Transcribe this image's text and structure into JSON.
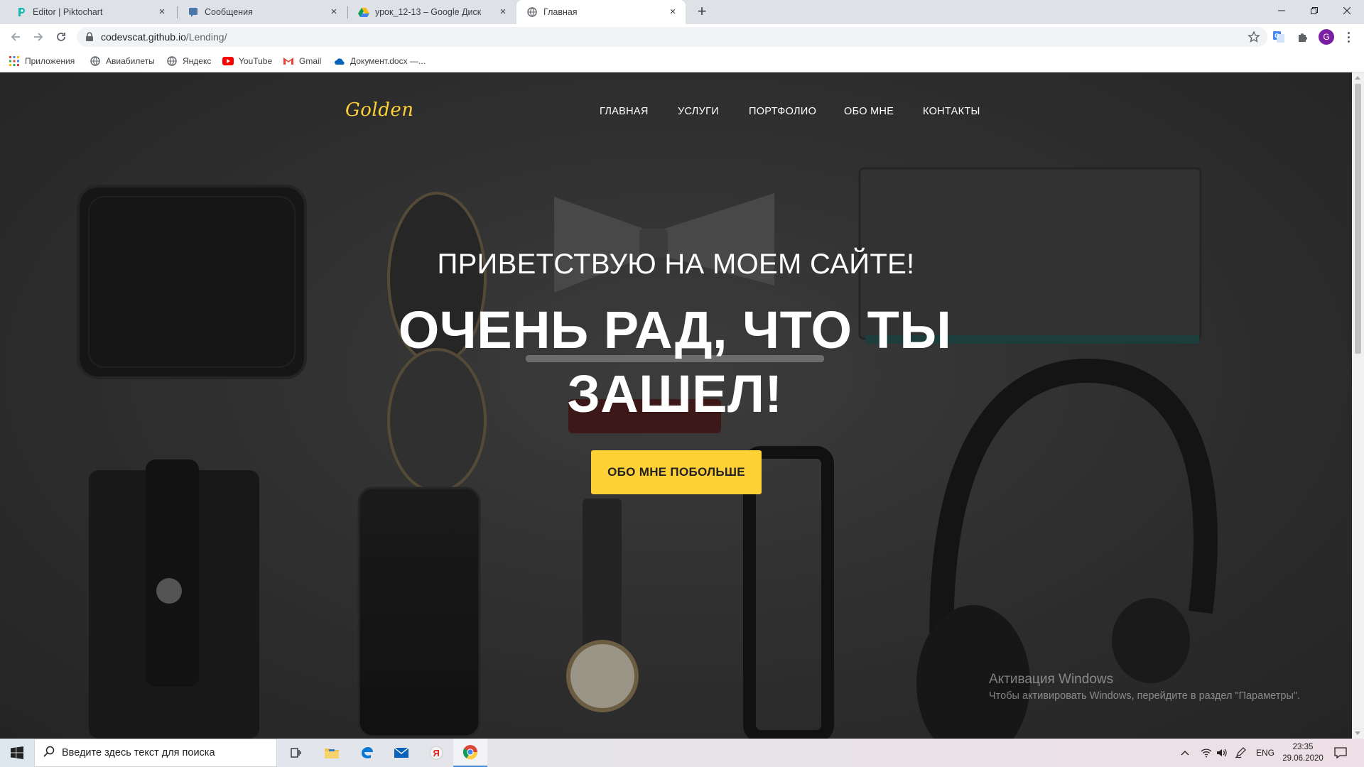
{
  "browser": {
    "tabs": [
      {
        "title": "Editor | Piktochart",
        "icon": "piktochart-icon",
        "active": false
      },
      {
        "title": "Сообщения",
        "icon": "vk-messages-icon",
        "active": false
      },
      {
        "title": "урок_12-13 – Google Диск",
        "icon": "google-drive-icon",
        "active": false
      },
      {
        "title": "Главная",
        "icon": "globe-icon",
        "active": true
      }
    ],
    "url_host": "codevscat.github.io",
    "url_path": "/Lending/",
    "profile_letter": "G",
    "bookmarks": [
      {
        "label": "Приложения",
        "icon": "apps-grid-icon"
      },
      {
        "label": "Авиабилеты",
        "icon": "globe-icon"
      },
      {
        "label": "Яндекс",
        "icon": "globe-icon"
      },
      {
        "label": "YouTube",
        "icon": "youtube-icon"
      },
      {
        "label": "Gmail",
        "icon": "gmail-icon"
      },
      {
        "label": "Документ.docx —...",
        "icon": "onedrive-icon"
      }
    ]
  },
  "site": {
    "logo": "Golden",
    "nav": [
      "ГЛАВНАЯ",
      "УСЛУГИ",
      "ПОРТФОЛИО",
      "ОБО МНЕ",
      "КОНТАКТЫ"
    ],
    "hero_subtitle": "ПРИВЕТСТВУЮ НА МОЕМ САЙТЕ!",
    "hero_title": "ОЧЕНЬ РАД, ЧТО ТЫ ЗАШЕЛ!",
    "cta": "ОБО МНЕ ПОБОЛЬШЕ",
    "accent_color": "#fed136"
  },
  "watermark": {
    "line1": "Активация Windows",
    "line2": "Чтобы активировать Windows, перейдите в раздел \"Параметры\"."
  },
  "taskbar": {
    "search_placeholder": "Введите здесь текст для поиска",
    "lang": "ENG",
    "time": "23:35",
    "date": "29.06.2020"
  }
}
